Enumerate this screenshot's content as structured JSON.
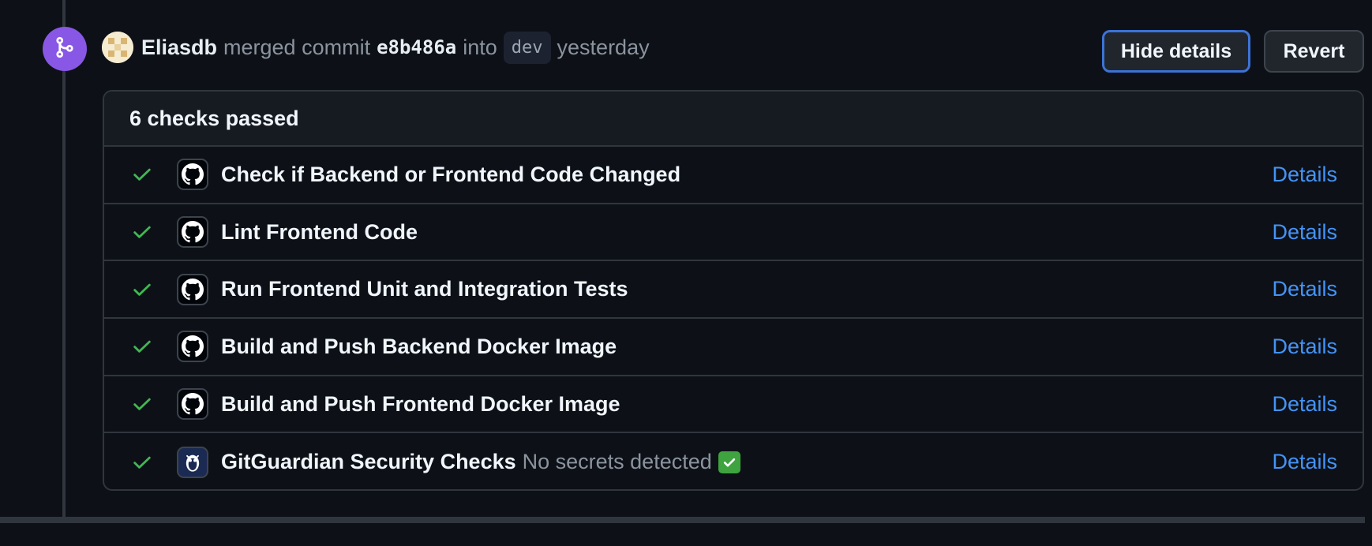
{
  "event": {
    "author": "Eliasdb",
    "action": "merged commit",
    "sha": "e8b486a",
    "into": "into",
    "branch": "dev",
    "time": "yesterday"
  },
  "buttons": {
    "hide_details": "Hide details",
    "revert": "Revert"
  },
  "checks": {
    "summary": "6 checks passed",
    "items": [
      {
        "name": "Check if Backend or Frontend Code Changed",
        "description": "",
        "app_icon": "github-icon",
        "details": "Details"
      },
      {
        "name": "Lint Frontend Code",
        "description": "",
        "app_icon": "github-icon",
        "details": "Details"
      },
      {
        "name": "Run Frontend Unit and Integration Tests",
        "description": "",
        "app_icon": "github-icon",
        "details": "Details"
      },
      {
        "name": "Build and Push Backend Docker Image",
        "description": "",
        "app_icon": "github-icon",
        "details": "Details"
      },
      {
        "name": "Build and Push Frontend Docker Image",
        "description": "",
        "app_icon": "github-icon",
        "details": "Details"
      },
      {
        "name": "GitGuardian Security Checks",
        "description": "No secrets detected",
        "app_icon": "gitguardian-icon",
        "details": "Details"
      }
    ]
  },
  "colors": {
    "merge_purple": "#8957e5",
    "success_green": "#3fb950",
    "link_blue": "#4493f8",
    "focus_blue": "#3b73d8"
  }
}
